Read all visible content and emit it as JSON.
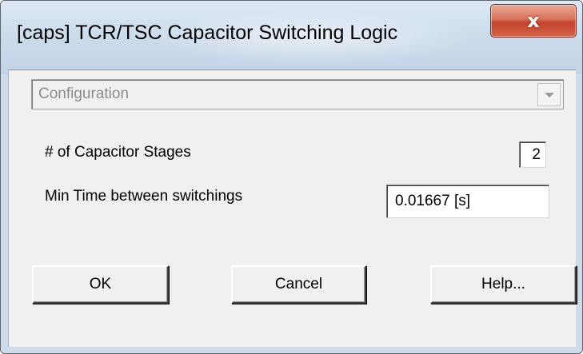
{
  "window": {
    "title": "[caps] TCR/TSC Capacitor Switching Logic",
    "close_glyph": "x",
    "close_icon": "close-icon"
  },
  "category_select": {
    "value": "Configuration",
    "arrow_icon": "chevron-down-icon"
  },
  "fields": [
    {
      "label": "# of Capacitor Stages",
      "value": "2"
    },
    {
      "label": "Min Time between switchings",
      "value": "0.01667 [s]"
    }
  ],
  "buttons": {
    "ok": "OK",
    "cancel": "Cancel",
    "help": "Help..."
  },
  "colors": {
    "title_bar": "#cddcec",
    "close_button": "#c4432b",
    "client_background": "#f0f0f0"
  }
}
